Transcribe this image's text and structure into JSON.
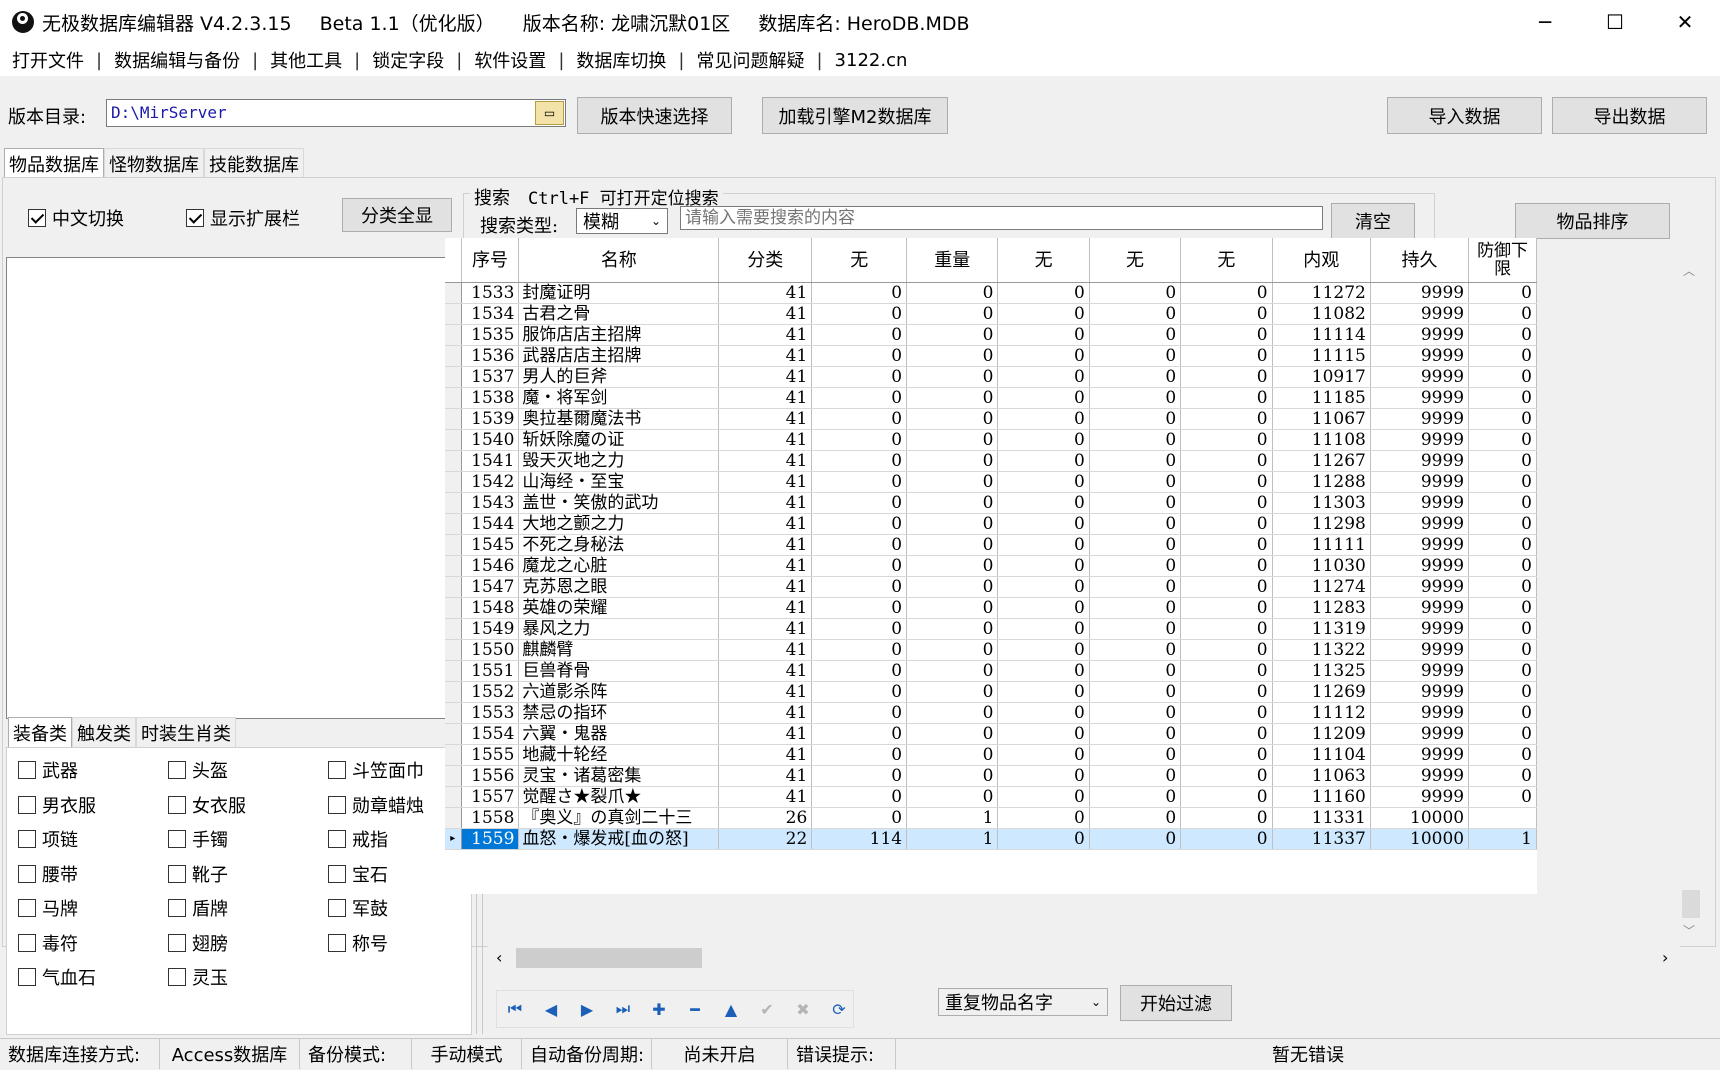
{
  "window": {
    "title": "无极数据库编辑器 V4.2.3.15",
    "beta": "Beta 1.1（优化版）",
    "version_name": "版本名称: 龙啸沉默01区",
    "db_name": "数据库名: HeroDB.MDB"
  },
  "menu": [
    "打开文件",
    "数据编辑与备份",
    "其他工具",
    "锁定字段",
    "软件设置",
    "数据库切换",
    "常见问题解疑",
    "3122.cn"
  ],
  "toolbar": {
    "dir_label": "版本目录:",
    "dir_value": "D:\\MirServer",
    "quick_select": "版本快速选择",
    "load_m2": "加载引擎M2数据库",
    "import": "导入数据",
    "export": "导出数据"
  },
  "db_tabs": [
    "物品数据库",
    "怪物数据库",
    "技能数据库"
  ],
  "options": {
    "chinese_switch": "中文切换",
    "show_ext": "显示扩展栏",
    "show_all_cats": "分类全显"
  },
  "search": {
    "title": "搜索",
    "hint": "Ctrl+F 可打开定位搜索",
    "type_label": "搜索类型:",
    "type_value": "模糊",
    "placeholder": "请输入需要搜索的内容",
    "clear": "清空",
    "sort": "物品排序"
  },
  "cat_tabs": [
    "装备类",
    "触发类",
    "时装生肖类"
  ],
  "categories": [
    [
      {
        "label": "武器"
      },
      {
        "label": "头盔"
      },
      {
        "label": "斗笠面巾"
      }
    ],
    [
      {
        "label": "男衣服"
      },
      {
        "label": "女衣服"
      },
      {
        "label": "勋章蜡烛"
      }
    ],
    [
      {
        "label": "项链"
      },
      {
        "label": "手镯"
      },
      {
        "label": "戒指"
      }
    ],
    [
      {
        "label": "腰带"
      },
      {
        "label": "靴子"
      },
      {
        "label": "宝石"
      }
    ],
    [
      {
        "label": "马牌"
      },
      {
        "label": "盾牌"
      },
      {
        "label": "军鼓"
      }
    ],
    [
      {
        "label": "毒符"
      },
      {
        "label": "翅膀"
      },
      {
        "label": "称号"
      }
    ],
    [
      {
        "label": "气血石"
      },
      {
        "label": "灵玉"
      }
    ]
  ],
  "grid": {
    "columns": [
      "序号",
      "名称",
      "分类",
      "无",
      "重量",
      "无",
      "无",
      "无",
      "内观",
      "持久",
      "防御下限"
    ],
    "rows": [
      [
        "1533",
        "封魔证明",
        "41",
        "0",
        "0",
        "0",
        "0",
        "0",
        "11272",
        "9999",
        "0"
      ],
      [
        "1534",
        "古君之骨",
        "41",
        "0",
        "0",
        "0",
        "0",
        "0",
        "11082",
        "9999",
        "0"
      ],
      [
        "1535",
        "服饰店店主招牌",
        "41",
        "0",
        "0",
        "0",
        "0",
        "0",
        "11114",
        "9999",
        "0"
      ],
      [
        "1536",
        "武器店店主招牌",
        "41",
        "0",
        "0",
        "0",
        "0",
        "0",
        "11115",
        "9999",
        "0"
      ],
      [
        "1537",
        "男人的巨斧",
        "41",
        "0",
        "0",
        "0",
        "0",
        "0",
        "10917",
        "9999",
        "0"
      ],
      [
        "1538",
        "魔・将军剑",
        "41",
        "0",
        "0",
        "0",
        "0",
        "0",
        "11185",
        "9999",
        "0"
      ],
      [
        "1539",
        "奥拉基爾魔法书",
        "41",
        "0",
        "0",
        "0",
        "0",
        "0",
        "11067",
        "9999",
        "0"
      ],
      [
        "1540",
        "斩妖除魔の证",
        "41",
        "0",
        "0",
        "0",
        "0",
        "0",
        "11108",
        "9999",
        "0"
      ],
      [
        "1541",
        "毁天灭地之力",
        "41",
        "0",
        "0",
        "0",
        "0",
        "0",
        "11267",
        "9999",
        "0"
      ],
      [
        "1542",
        "山海经・至宝",
        "41",
        "0",
        "0",
        "0",
        "0",
        "0",
        "11288",
        "9999",
        "0"
      ],
      [
        "1543",
        "盖世・笑傲的武功",
        "41",
        "0",
        "0",
        "0",
        "0",
        "0",
        "11303",
        "9999",
        "0"
      ],
      [
        "1544",
        "大地之颤之力",
        "41",
        "0",
        "0",
        "0",
        "0",
        "0",
        "11298",
        "9999",
        "0"
      ],
      [
        "1545",
        "不死之身秘法",
        "41",
        "0",
        "0",
        "0",
        "0",
        "0",
        "11111",
        "9999",
        "0"
      ],
      [
        "1546",
        "魔龙之心脏",
        "41",
        "0",
        "0",
        "0",
        "0",
        "0",
        "11030",
        "9999",
        "0"
      ],
      [
        "1547",
        "克苏恩之眼",
        "41",
        "0",
        "0",
        "0",
        "0",
        "0",
        "11274",
        "9999",
        "0"
      ],
      [
        "1548",
        "英雄の荣耀",
        "41",
        "0",
        "0",
        "0",
        "0",
        "0",
        "11283",
        "9999",
        "0"
      ],
      [
        "1549",
        "暴风之力",
        "41",
        "0",
        "0",
        "0",
        "0",
        "0",
        "11319",
        "9999",
        "0"
      ],
      [
        "1550",
        "麒麟臂",
        "41",
        "0",
        "0",
        "0",
        "0",
        "0",
        "11322",
        "9999",
        "0"
      ],
      [
        "1551",
        "巨兽脊骨",
        "41",
        "0",
        "0",
        "0",
        "0",
        "0",
        "11325",
        "9999",
        "0"
      ],
      [
        "1552",
        "六道影杀阵",
        "41",
        "0",
        "0",
        "0",
        "0",
        "0",
        "11269",
        "9999",
        "0"
      ],
      [
        "1553",
        "禁忌の指环",
        "41",
        "0",
        "0",
        "0",
        "0",
        "0",
        "11112",
        "9999",
        "0"
      ],
      [
        "1554",
        "六翼・鬼器",
        "41",
        "0",
        "0",
        "0",
        "0",
        "0",
        "11209",
        "9999",
        "0"
      ],
      [
        "1555",
        "地藏十轮经",
        "41",
        "0",
        "0",
        "0",
        "0",
        "0",
        "11104",
        "9999",
        "0"
      ],
      [
        "1556",
        "灵宝・诸葛密集",
        "41",
        "0",
        "0",
        "0",
        "0",
        "0",
        "11063",
        "9999",
        "0"
      ],
      [
        "1557",
        "觉醒さ★裂爪★",
        "41",
        "0",
        "0",
        "0",
        "0",
        "0",
        "11160",
        "9999",
        "0"
      ],
      [
        "1558",
        "『奥义』の真剑二十三",
        "26",
        "0",
        "1",
        "0",
        "0",
        "0",
        "11331",
        "10000",
        ""
      ],
      [
        "1559",
        "血怒・爆发戒[血の怒]",
        "22",
        "114",
        "1",
        "0",
        "0",
        "0",
        "11337",
        "10000",
        "1"
      ]
    ]
  },
  "filter": {
    "type_value": "重复物品名字",
    "start": "开始过滤"
  },
  "status": {
    "conn_label": "数据库连接方式:",
    "conn_value": "Access数据库",
    "backup_label": "备份模式:",
    "backup_value": "手动模式",
    "auto_label": "自动备份周期:",
    "auto_value": "尚未开启",
    "error_label": "错误提示:",
    "error_value": "暂无错误"
  }
}
